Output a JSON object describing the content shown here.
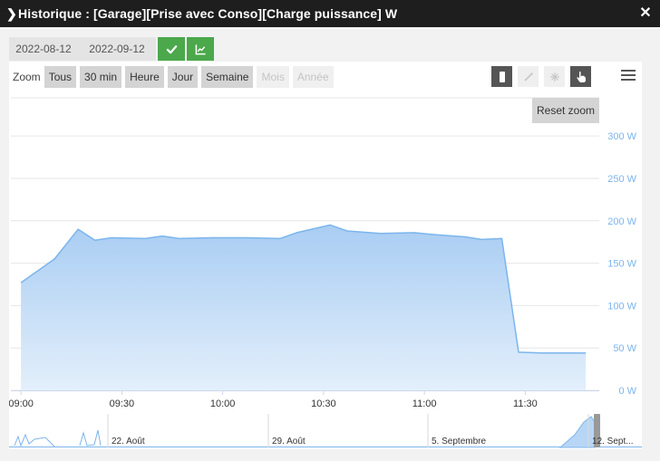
{
  "window": {
    "title": "Historique : [Garage][Prise avec Conso][Charge puissance] W"
  },
  "toolbar": {
    "date_start": "2022-08-12",
    "date_end": "2022-09-12"
  },
  "zoom": {
    "label": "Zoom",
    "buttons": [
      {
        "label": "Tous",
        "enabled": true
      },
      {
        "label": "30 min",
        "enabled": true
      },
      {
        "label": "Heure",
        "enabled": true
      },
      {
        "label": "Jour",
        "enabled": true
      },
      {
        "label": "Semaine",
        "enabled": true
      },
      {
        "label": "Mois",
        "enabled": false
      },
      {
        "label": "Année",
        "enabled": false
      }
    ],
    "reset_label": "Reset zoom"
  },
  "colors": {
    "accent_green": "#4ba84b",
    "series_line": "#7cb5ec",
    "axis_label": "#7cb5ec"
  },
  "chart_data": {
    "type": "area",
    "x_unit": "minutes after 09:00",
    "x": [
      0,
      10,
      17,
      22,
      27,
      37,
      42,
      47,
      57,
      67,
      77,
      82,
      92,
      97,
      107,
      117,
      122,
      132,
      137,
      143,
      148,
      155,
      162,
      168
    ],
    "y": [
      127,
      155,
      190,
      177,
      180,
      179,
      182,
      179,
      180,
      180,
      179,
      186,
      195,
      188,
      185,
      186,
      184,
      181,
      178,
      179,
      45,
      44,
      44,
      44
    ],
    "xlim": [
      -3,
      172
    ],
    "ylim": [
      0,
      345
    ],
    "x_ticks": [
      {
        "v": 0,
        "label": "09:00"
      },
      {
        "v": 30,
        "label": "09:30"
      },
      {
        "v": 60,
        "label": "10:00"
      },
      {
        "v": 90,
        "label": "10:30"
      },
      {
        "v": 120,
        "label": "11:00"
      },
      {
        "v": 150,
        "label": "11:30"
      }
    ],
    "y_ticks": [
      {
        "v": 0,
        "label": "0 W"
      },
      {
        "v": 50,
        "label": "50 W"
      },
      {
        "v": 100,
        "label": "100 W"
      },
      {
        "v": 150,
        "label": "150 W"
      },
      {
        "v": 200,
        "label": "200 W"
      },
      {
        "v": 250,
        "label": "250 W"
      },
      {
        "v": 300,
        "label": "300 W"
      }
    ],
    "grid": true,
    "navigator": {
      "labels": [
        "22. Août",
        "29. Août",
        "5. Septembre",
        "12. Sept..."
      ]
    }
  }
}
